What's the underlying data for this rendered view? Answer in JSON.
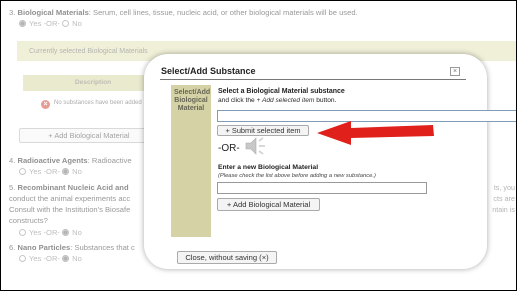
{
  "background": {
    "q3": {
      "number": "3.",
      "title": "Biological Materials",
      "text": ": Serum, cell lines, tissue, nucleic acid, or other biological materials will be used.",
      "yes": "Yes",
      "or": "-OR-",
      "no": "No"
    },
    "panel_header": "Currently selected Biological Materials",
    "description_header": "Description",
    "no_substances": "No substances have been added",
    "add_button": "+ Add Biological Material",
    "q4": {
      "number": "4.",
      "title": "Radioactive Agents",
      "text": ": Radioactive",
      "yes": "Yes",
      "or": "-OR-",
      "no": "No"
    },
    "q5": {
      "number": "5.",
      "title": "Recombinant Nucleic Acid and",
      "line2": "conduct the animal experiments acc",
      "line3": "Consult with the Institution's Biosafe",
      "line4": "constructs?",
      "right1": "ts, you",
      "right2": "cts are",
      "right3": "ntain is",
      "yes": "Yes",
      "or": "-OR-",
      "no": "No"
    },
    "q6": {
      "number": "6.",
      "title": "Nano Particles",
      "text": ": Substances that c",
      "yes": "Yes",
      "or": "-OR-",
      "no": "No"
    }
  },
  "modal": {
    "title": "Select/Add Substance",
    "close_icon": "close-x",
    "tab_label": "Select/Add Biological Material",
    "select_title": "Select a Biological Material substance",
    "select_sub_prefix": "and click the",
    "select_sub_italic": "+ Add selected item",
    "select_sub_suffix": "button.",
    "submit_button": "+ Submit selected item",
    "or_label": "-OR-",
    "speaker_icon": "speaker-icon",
    "enter_title": "Enter a new Biological Material",
    "enter_note": "(Please check the list above before adding a new substance.)",
    "add_button": "+ Add Biological Material",
    "close_button": "Close, without saving (×)"
  },
  "annotation": {
    "arrow_color": "#e0201b"
  }
}
